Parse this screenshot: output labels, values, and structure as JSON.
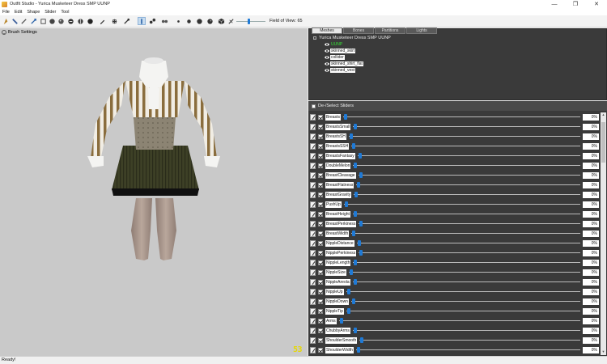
{
  "window": {
    "title": "Outfit Studio - Yurica Musketeer Dress SMP UUNP",
    "minimize": "—",
    "maximize": "❐",
    "close": "✕"
  },
  "menu": [
    "File",
    "Edit",
    "Shape",
    "Slider",
    "Tool"
  ],
  "toolbar": {
    "field_of_view_label": "Field of View: 65",
    "fov_value": 65
  },
  "viewport": {
    "brush_settings_label": "Brush Settings",
    "fps": "53"
  },
  "tabs": [
    {
      "label": "Meshes",
      "selected": true
    },
    {
      "label": "Bones",
      "selected": false
    },
    {
      "label": "Partitions",
      "selected": false
    },
    {
      "label": "Lights",
      "selected": false
    }
  ],
  "mesh_tree": {
    "root": "Yurica Musketeer Dress SMP UUNP",
    "items": [
      {
        "label": "UUNP",
        "highlight": true
      },
      {
        "label": "skinned_skirt",
        "highlight": false
      },
      {
        "label": "collider",
        "highlight": false
      },
      {
        "label": "skinned_shirt_flat",
        "highlight": false
      },
      {
        "label": "skinned_vest",
        "highlight": false
      }
    ]
  },
  "slider_panel": {
    "header_label": "De-/Select Sliders",
    "sliders": [
      {
        "name": "Breasts",
        "value": "0%"
      },
      {
        "name": "BreastsSmall",
        "value": "0%"
      },
      {
        "name": "BreastsSH",
        "value": "0%"
      },
      {
        "name": "BreastsSSH",
        "value": "0%"
      },
      {
        "name": "BreastsFantasy",
        "value": "0%"
      },
      {
        "name": "DoubleMelon",
        "value": "0%"
      },
      {
        "name": "BreastCleavage",
        "value": "0%"
      },
      {
        "name": "BreastFlatness",
        "value": "0%"
      },
      {
        "name": "BreastGravity",
        "value": "0%"
      },
      {
        "name": "PushUp",
        "value": "0%"
      },
      {
        "name": "BreastHeight",
        "value": "0%"
      },
      {
        "name": "BreastPerkiness",
        "value": "0%"
      },
      {
        "name": "BreastWidth",
        "value": "0%"
      },
      {
        "name": "NippleDistance",
        "value": "0%"
      },
      {
        "name": "NipplePerkiness",
        "value": "0%"
      },
      {
        "name": "NippleLength",
        "value": "0%"
      },
      {
        "name": "NippleSize",
        "value": "0%"
      },
      {
        "name": "NippleAreola",
        "value": "0%"
      },
      {
        "name": "NippleUp",
        "value": "0%"
      },
      {
        "name": "NippleDown",
        "value": "0%"
      },
      {
        "name": "NippleTip",
        "value": "0%"
      },
      {
        "name": "Arms",
        "value": "0%"
      },
      {
        "name": "ChubbyArms",
        "value": "0%"
      },
      {
        "name": "ShoulderSmooth",
        "value": "0%"
      },
      {
        "name": "ShoulderWidth",
        "value": "0%"
      }
    ]
  },
  "status": "Ready!",
  "colors": {
    "accent": "#1f7ad6",
    "panel_bg": "#3a3a3a",
    "viewport_bg": "#c9c9c9",
    "fps_color": "#e6d800",
    "highlight_mesh": "#34e034"
  }
}
